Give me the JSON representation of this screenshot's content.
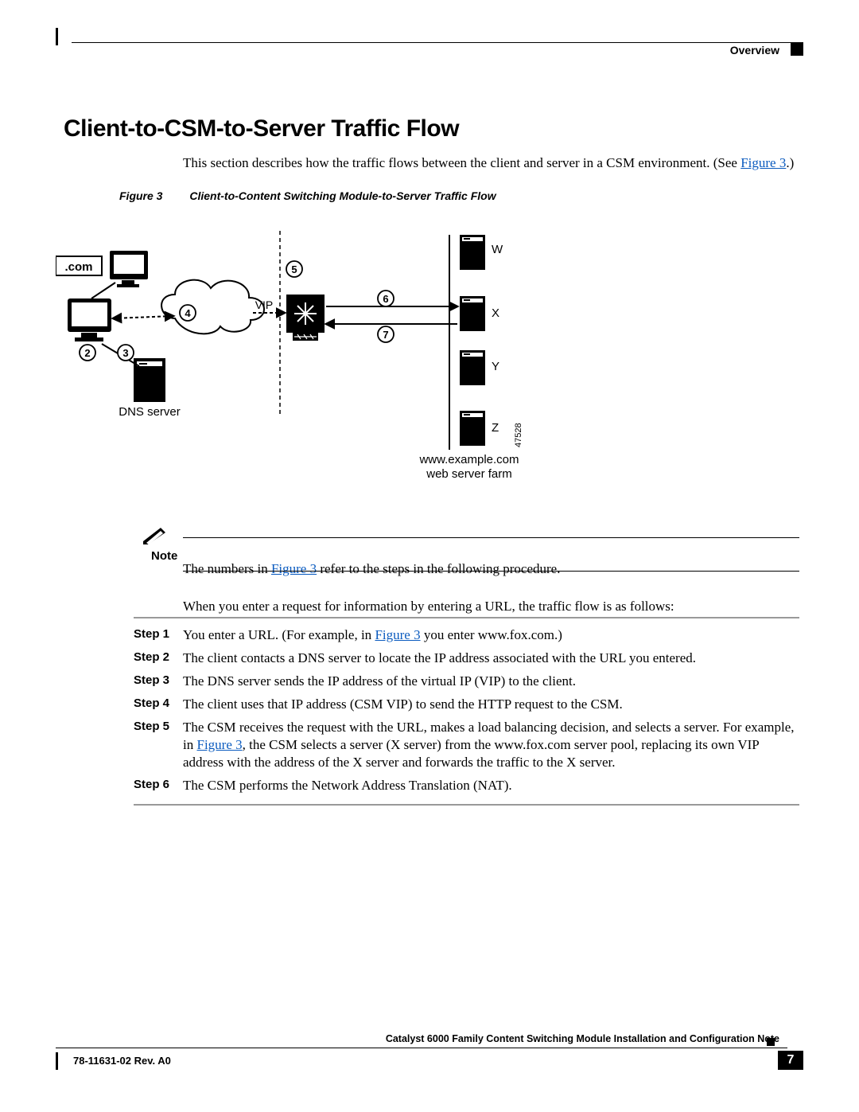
{
  "header": {
    "chapter": "Overview"
  },
  "title": "Client-to-CSM-to-Server Traffic Flow",
  "intro_pre": "This section describes how the traffic flows between the client and server in a CSM environment. (See ",
  "intro_link": "Figure 3",
  "intro_post": ".)",
  "figure": {
    "num": "Figure 3",
    "title": "Client-to-Content Switching Module-to-Server Traffic Flow",
    "labels": {
      "dotcom": ".com",
      "vip": "VIP",
      "dns": "DNS server",
      "w": "W",
      "x": "X",
      "y": "Y",
      "z": "Z",
      "farm1": "www.example.com",
      "farm2": "web server farm",
      "id": "47528"
    },
    "callouts": [
      "2",
      "3",
      "4",
      "5",
      "6",
      "7"
    ]
  },
  "note": {
    "label": "Note",
    "text_pre": "The numbers in ",
    "text_link": "Figure 3",
    "text_post": " refer to the steps in the following procedure."
  },
  "intro2": "When you enter a request for information by entering a URL, the traffic flow is as follows:",
  "steps": [
    {
      "label": "Step 1",
      "pre": "You enter a URL. (For example, in ",
      "link": "Figure 3",
      "post": " you enter www.fox.com.)"
    },
    {
      "label": "Step 2",
      "text": "The client contacts a DNS server to locate the IP address associated with the URL you entered."
    },
    {
      "label": "Step 3",
      "text": "The DNS server sends the IP address of the virtual IP (VIP) to the client."
    },
    {
      "label": "Step 4",
      "text": "The client uses that IP address (CSM VIP) to send the HTTP request to the CSM."
    },
    {
      "label": "Step 5",
      "pre": "The CSM receives the request with the URL, makes a load balancing decision, and selects a server. For example, in ",
      "link": "Figure 3",
      "post": ", the CSM selects a server (X server) from the www.fox.com server pool, replacing its own VIP address with the address of the X server and forwards the traffic to the X server."
    },
    {
      "label": "Step 6",
      "text": "The CSM performs the Network Address Translation (NAT)."
    }
  ],
  "footer": {
    "doc": "Catalyst 6000 Family Content Switching Module Installation and Configuration Note",
    "rev": "78-11631-02 Rev. A0",
    "page": "7"
  }
}
